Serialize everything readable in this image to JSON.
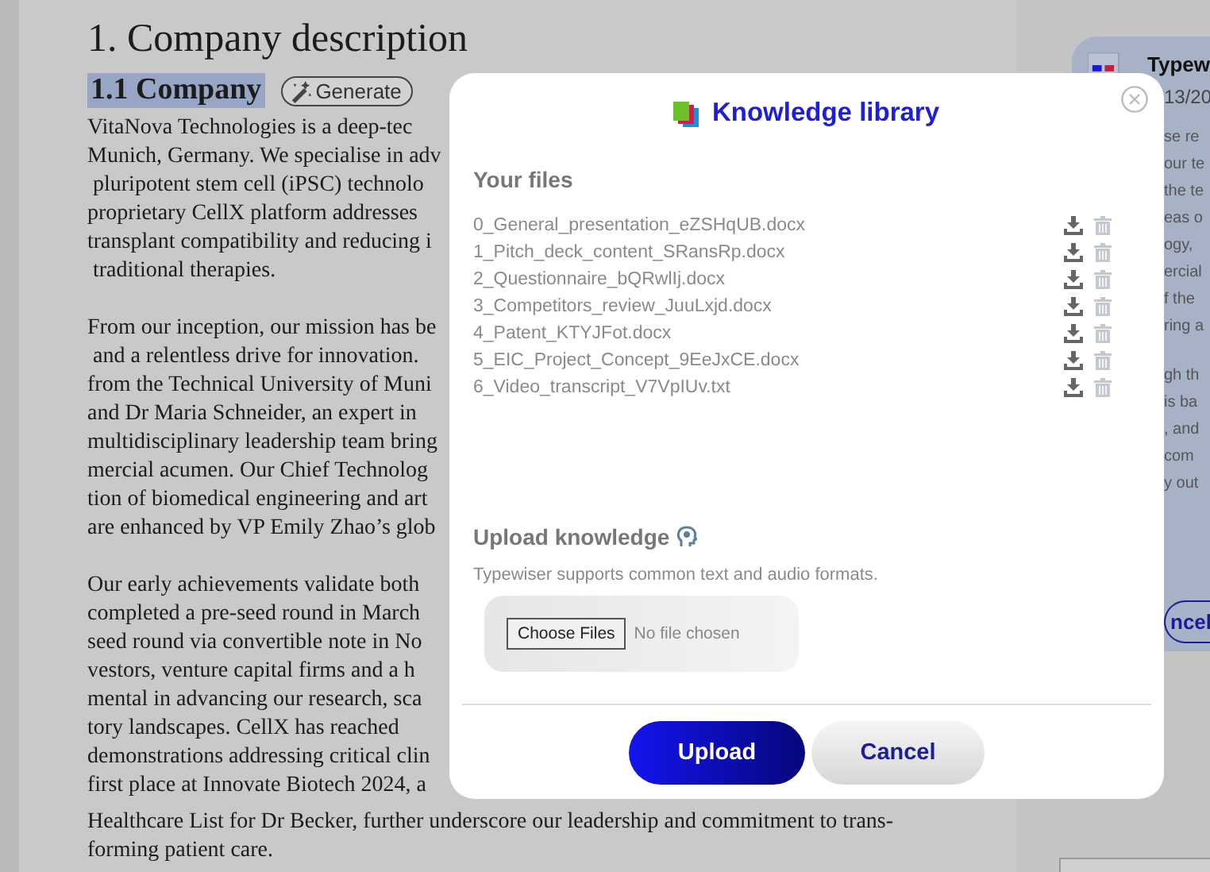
{
  "document": {
    "title": "1. Company description",
    "heading": "1.1 Company",
    "generate_button": "Generate",
    "paragraphs": [
      [
        "VitaNova Technologies is a deep-tec",
        "Munich, Germany. We specialise in adv",
        " pluripotent stem cell (iPSC) technolo",
        "proprietary CellX platform addresses",
        "transplant compatibility and reducing i",
        " traditional therapies."
      ],
      [
        "From our inception, our mission has be",
        " and a relentless drive for innovation.",
        "from the Technical University of Muni",
        "and Dr Maria Schneider, an expert in",
        "multidisciplinary leadership team bring",
        "mercial acumen. Our Chief Technolog",
        "tion of biomedical engineering and art",
        "are enhanced by VP Emily Zhao’s glob"
      ],
      [
        "Our early achievements validate both",
        "completed a pre-seed round in March",
        "seed round via convertible note in No",
        "vestors, venture capital firms and a h",
        "mental in advancing our research, sca",
        "tory landscapes. CellX has reached",
        "demonstrations addressing critical clin",
        "first place at Innovate Biotech 2024, a"
      ]
    ],
    "tail_lines": [
      "Healthcare List for Dr Becker, further underscore our leadership and commitment to trans-",
      "forming patient care."
    ]
  },
  "side_card": {
    "title": "Typew",
    "date": "13/20",
    "paragraphs": [
      [
        "se re",
        "our te",
        "the te",
        "eas o",
        "ogy,",
        "ercial",
        "f the",
        "ring a"
      ],
      [
        "gh th",
        "is ba",
        ", and",
        "com",
        "y out"
      ]
    ],
    "button": "ncel"
  },
  "dialog": {
    "title": "Knowledge library",
    "files_heading": "Your files",
    "files": [
      {
        "name": "0_General_presentation_eZSHqUB.docx"
      },
      {
        "name": "1_Pitch_deck_content_SRansRp.docx"
      },
      {
        "name": "2_Questionnaire_bQRwlIj.docx"
      },
      {
        "name": "3_Competitors_review_JuuLxjd.docx"
      },
      {
        "name": "4_Patent_KTYJFot.docx"
      },
      {
        "name": "5_EIC_Project_Concept_9EeJxCE.docx"
      },
      {
        "name": "6_Video_transcript_V7VpIUv.txt"
      }
    ],
    "upload_heading": "Upload knowledge",
    "upload_hint": "Typewiser supports common text and audio formats.",
    "file_input": {
      "button": "Choose Files",
      "status": "No file chosen"
    },
    "buttons": [
      {
        "label": "Upload",
        "kind": "primary"
      },
      {
        "label": "Cancel",
        "kind": "secondary"
      }
    ]
  }
}
